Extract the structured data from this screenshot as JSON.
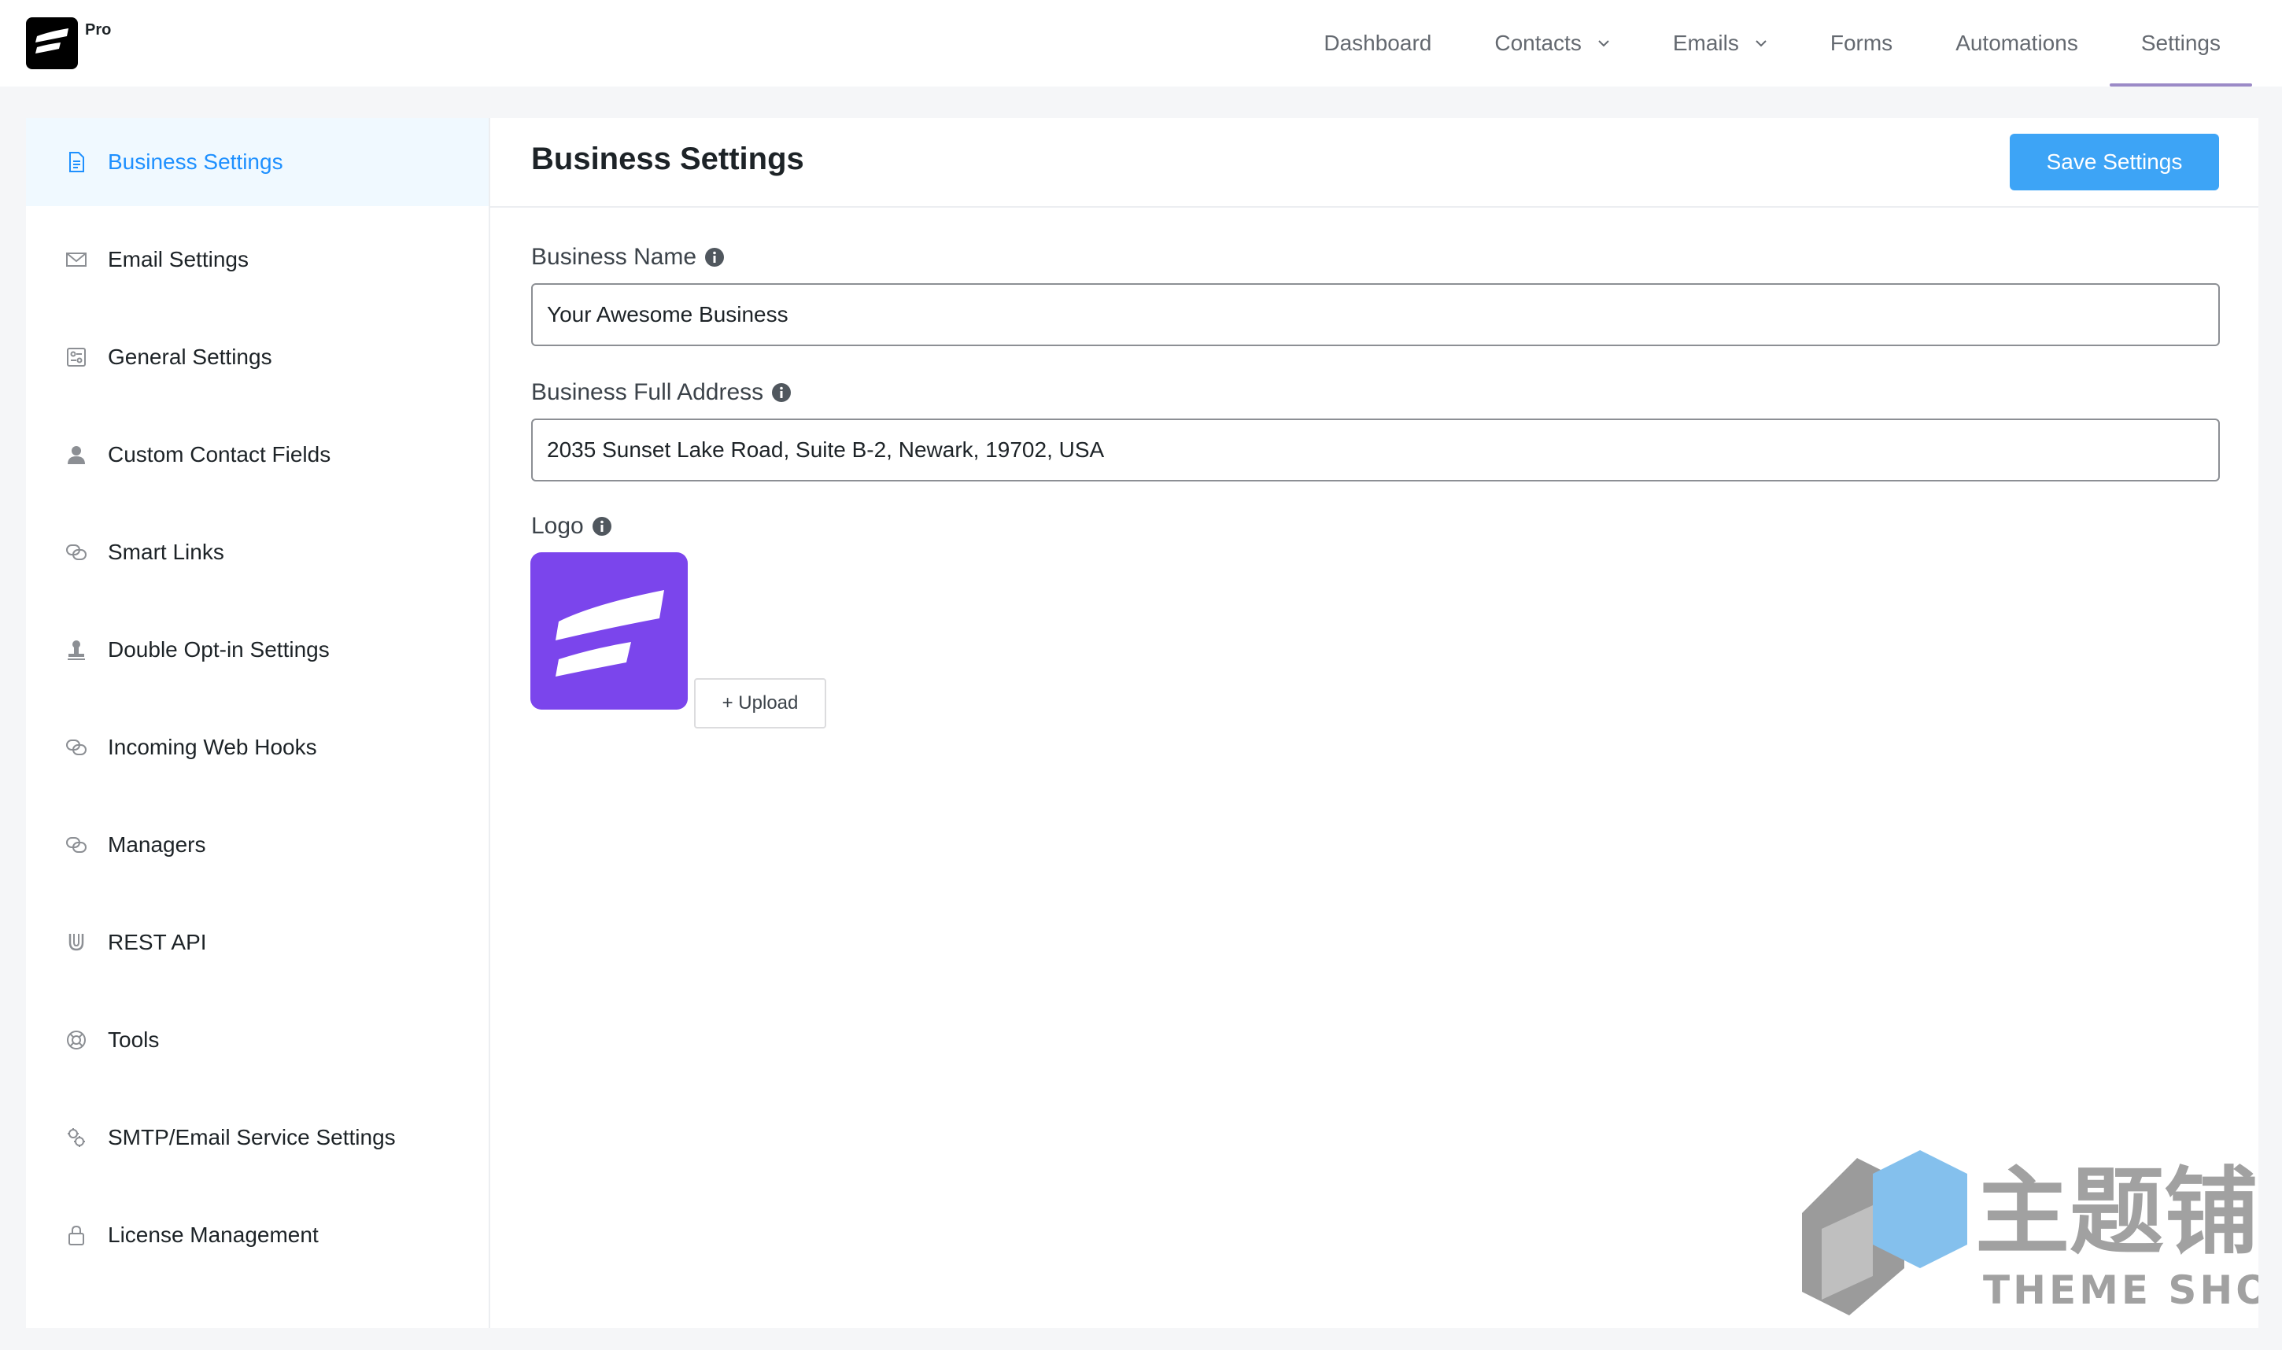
{
  "brand": {
    "badge": "Pro",
    "logo_icon": "fluentcrm-logo-icon"
  },
  "nav": {
    "items": [
      {
        "label": "Dashboard",
        "dropdown": false,
        "active": false
      },
      {
        "label": "Contacts",
        "dropdown": true,
        "active": false
      },
      {
        "label": "Emails",
        "dropdown": true,
        "active": false
      },
      {
        "label": "Forms",
        "dropdown": false,
        "active": false
      },
      {
        "label": "Automations",
        "dropdown": false,
        "active": false
      },
      {
        "label": "Settings",
        "dropdown": false,
        "active": true
      }
    ],
    "active_underline_color": "#9b8ac7"
  },
  "sidebar": {
    "items": [
      {
        "label": "Business Settings",
        "icon": "document-icon",
        "active": true
      },
      {
        "label": "Email Settings",
        "icon": "envelope-icon",
        "active": false
      },
      {
        "label": "General Settings",
        "icon": "sliders-icon",
        "active": false
      },
      {
        "label": "Custom Contact Fields",
        "icon": "person-icon",
        "active": false
      },
      {
        "label": "Smart Links",
        "icon": "link-icon",
        "active": false
      },
      {
        "label": "Double Opt-in Settings",
        "icon": "stamp-icon",
        "active": false
      },
      {
        "label": "Incoming Web Hooks",
        "icon": "link-icon",
        "active": false
      },
      {
        "label": "Managers",
        "icon": "link-icon",
        "active": false
      },
      {
        "label": "REST API",
        "icon": "magnet-icon",
        "active": false
      },
      {
        "label": "Tools",
        "icon": "lifebuoy-icon",
        "active": false
      },
      {
        "label": "SMTP/Email Service Settings",
        "icon": "gears-icon",
        "active": false
      },
      {
        "label": "License Management",
        "icon": "lock-icon",
        "active": false
      }
    ],
    "active_color": "#1e90ff",
    "active_bg": "#f0f9ff"
  },
  "main": {
    "title": "Business Settings",
    "save_label": "Save Settings",
    "save_color": "#3da4f6",
    "fields": {
      "business_name": {
        "label": "Business Name",
        "value": "Your Awesome Business"
      },
      "business_address": {
        "label": "Business Full Address",
        "value": "2035 Sunset Lake Road, Suite B-2, Newark, 19702, USA"
      },
      "logo": {
        "label": "Logo",
        "upload_label": "+ Upload",
        "logo_bg": "#7b45ec"
      }
    }
  },
  "watermark": {
    "text_cn": "主题铺",
    "text_en": "THEME SHOP"
  }
}
